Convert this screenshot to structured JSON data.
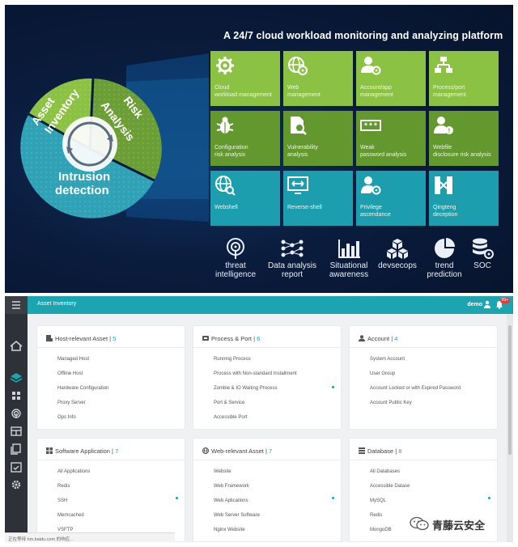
{
  "platform_title": "A 24/7 cloud workload monitoring and analyzing platform",
  "wheel": {
    "segments": [
      {
        "id": "asset",
        "lines": [
          "Asset",
          "Inventory"
        ],
        "color": "#8cc243"
      },
      {
        "id": "risk",
        "lines": [
          "Risk",
          "Analysis"
        ],
        "color": "#6b9e35"
      },
      {
        "id": "intrusion",
        "lines": [
          "Intrusion",
          "detection"
        ],
        "color": "#2fa2b6"
      }
    ]
  },
  "tiles": [
    {
      "icon": "gear-icon",
      "lines": [
        "Cloud",
        "workload management"
      ],
      "color": "green"
    },
    {
      "icon": "globe-gear-icon",
      "lines": [
        "Web",
        "management"
      ],
      "color": "green"
    },
    {
      "icon": "user-gear-icon",
      "lines": [
        "Account/app",
        "management"
      ],
      "color": "green"
    },
    {
      "icon": "process-tree-icon",
      "lines": [
        "Process/port",
        "management"
      ],
      "color": "green"
    },
    {
      "icon": "bug-icon",
      "lines": [
        "Configuration",
        "risk analysis"
      ],
      "color": "dgreen"
    },
    {
      "icon": "file-search-icon",
      "lines": [
        "Vulnerability",
        "analysis"
      ],
      "color": "dgreen"
    },
    {
      "icon": "password-icon",
      "lines": [
        "Weak",
        "password analysis"
      ],
      "color": "dgreen"
    },
    {
      "icon": "user-alert-icon",
      "lines": [
        "Webfile",
        "disclosure risk analysis"
      ],
      "color": "dgreen"
    },
    {
      "icon": "globe-search-icon",
      "lines": [
        "Webshell"
      ],
      "color": "teal"
    },
    {
      "icon": "terminal-icon",
      "lines": [
        "Reverse-shell"
      ],
      "color": "teal"
    },
    {
      "icon": "user-privilege-icon",
      "lines": [
        "Privilege",
        "ascendance"
      ],
      "color": "teal"
    },
    {
      "icon": "network-icon",
      "lines": [
        "Qingteng",
        "deception"
      ],
      "color": "teal"
    }
  ],
  "capabilities": [
    {
      "icon": "radar-icon",
      "lines": [
        "threat",
        "intelligence"
      ]
    },
    {
      "icon": "data-flow-icon",
      "lines": [
        "Data analysis",
        "report"
      ]
    },
    {
      "icon": "bar-chart-icon",
      "lines": [
        "Situational",
        "awareness"
      ]
    },
    {
      "icon": "cubes-icon",
      "lines": [
        "devsecops"
      ]
    },
    {
      "icon": "pie-chart-icon",
      "lines": [
        "trend",
        "prediction"
      ]
    },
    {
      "icon": "database-gear-icon",
      "lines": [
        "SOC"
      ]
    }
  ],
  "app": {
    "title": "Asset Inventory",
    "user": "demo",
    "notifications": "99+",
    "status_text": "正在等待 hm.baidu.com 的响应..."
  },
  "cards": [
    {
      "icon": "host-icon",
      "title": "Host-relevant Asset",
      "count": "5",
      "items": [
        "Managed Host",
        "Offline Host",
        "Hardware Configuration",
        "Proxy Server",
        "Ops Info"
      ],
      "dot": false
    },
    {
      "icon": "process-icon",
      "title": "Process & Port",
      "count": "6",
      "items": [
        "Running Process",
        "Process with Non-standard Installment",
        "Zombie & IO Waiting Process",
        "Port & Service",
        "Accessible Port"
      ],
      "dot": true
    },
    {
      "icon": "account-icon",
      "title": "Account",
      "count": "4",
      "items": [
        "System Account",
        "User Group",
        "Account Locked or with Expired Password",
        "Account Public Key"
      ],
      "dot": false
    },
    {
      "icon": "grid-icon",
      "title": "Software Application",
      "count": "7",
      "items": [
        "All Applications",
        "Redis",
        "SSH",
        "Memcached",
        "VSFTP"
      ],
      "dot": true
    },
    {
      "icon": "globe-icon",
      "title": "Web-relevant Asset",
      "count": "7",
      "items": [
        "Website",
        "Web Framework",
        "Web Aplications",
        "Web Server Software",
        "Nginx Website"
      ],
      "dot": true
    },
    {
      "icon": "database-icon",
      "title": "Database",
      "count": "8",
      "items": [
        "All Databases",
        "Accessible Datase",
        "MySQL",
        "Redis",
        "MongoDB"
      ],
      "dot": true
    }
  ],
  "watermark": "青藤云安全"
}
